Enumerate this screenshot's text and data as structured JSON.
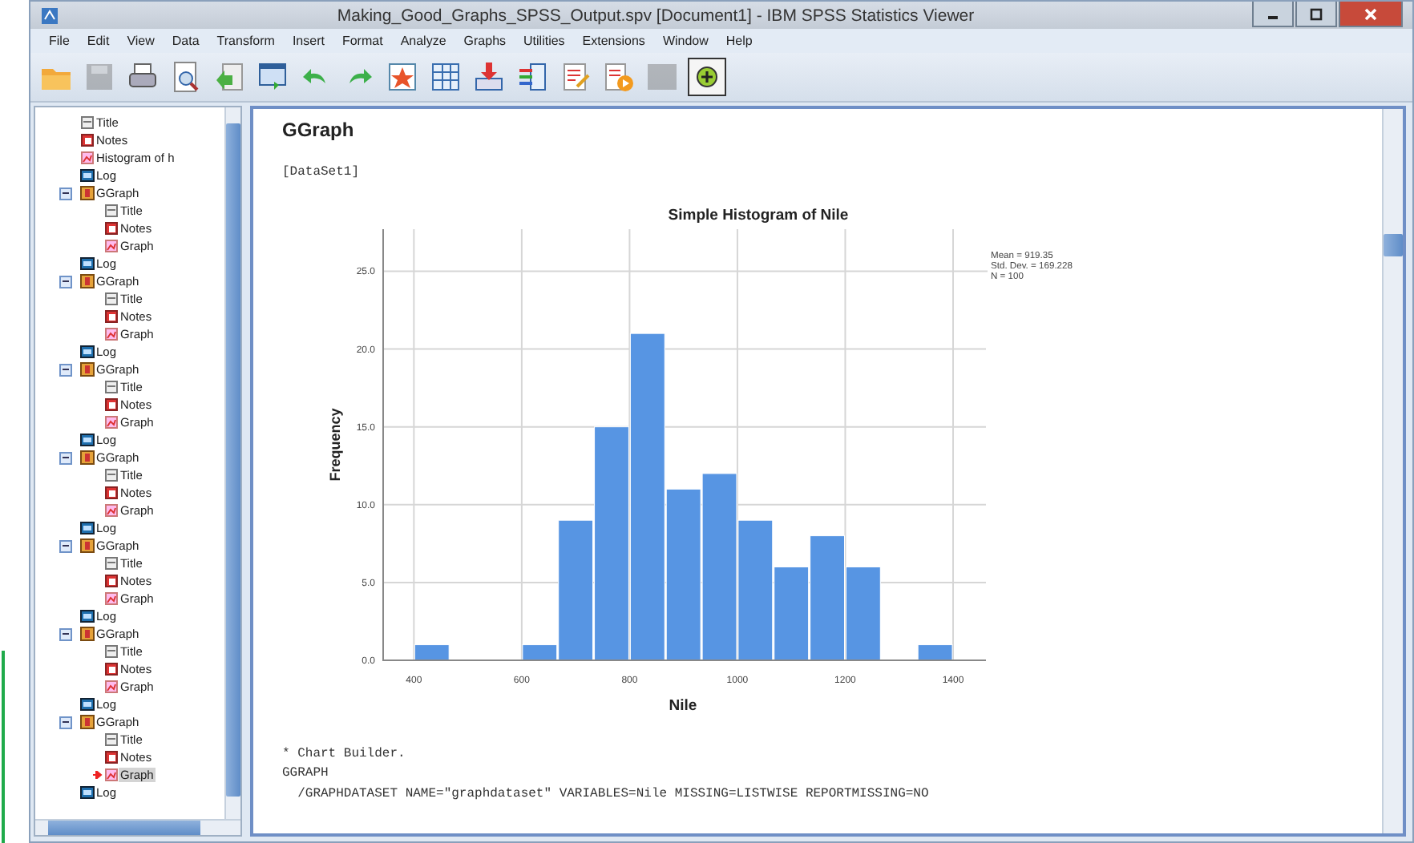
{
  "window": {
    "title": "Making_Good_Graphs_SPSS_Output.spv [Document1] - IBM SPSS Statistics Viewer"
  },
  "menu": [
    "File",
    "Edit",
    "View",
    "Data",
    "Transform",
    "Insert",
    "Format",
    "Analyze",
    "Graphs",
    "Utilities",
    "Extensions",
    "Window",
    "Help"
  ],
  "toolbar": [
    {
      "kind": "open",
      "disabled": false
    },
    {
      "kind": "save",
      "disabled": true
    },
    {
      "kind": "print",
      "disabled": false
    },
    {
      "kind": "preview",
      "disabled": false
    },
    {
      "kind": "export",
      "disabled": false
    },
    {
      "kind": "recall",
      "disabled": false
    },
    {
      "kind": "undo",
      "disabled": false
    },
    {
      "kind": "redo",
      "disabled": false
    },
    {
      "kind": "star",
      "disabled": false
    },
    {
      "kind": "grid",
      "disabled": false
    },
    {
      "kind": "download",
      "disabled": false
    },
    {
      "kind": "columns",
      "disabled": false
    },
    {
      "kind": "docpen",
      "disabled": false
    },
    {
      "kind": "docplay",
      "disabled": false
    },
    {
      "kind": "blank",
      "disabled": true
    },
    {
      "kind": "plus",
      "disabled": false
    }
  ],
  "outline": {
    "items": [
      {
        "kind": "group",
        "children": [
          {
            "kind": "title",
            "label": "Title",
            "selected": false
          },
          {
            "kind": "notes",
            "label": "Notes",
            "selected": false
          },
          {
            "kind": "graph",
            "label": "Histogram of h",
            "selected": false
          }
        ]
      },
      {
        "kind": "log",
        "label": "Log",
        "selected": false
      },
      {
        "kind": "ggraph",
        "label": "GGraph",
        "expanded": true,
        "selected": false,
        "children": [
          {
            "kind": "title",
            "label": "Title",
            "selected": false
          },
          {
            "kind": "notes",
            "label": "Notes",
            "selected": false
          },
          {
            "kind": "graph",
            "label": "Graph",
            "selected": false
          }
        ]
      },
      {
        "kind": "log",
        "label": "Log",
        "selected": false
      },
      {
        "kind": "ggraph",
        "label": "GGraph",
        "expanded": true,
        "selected": false,
        "children": [
          {
            "kind": "title",
            "label": "Title",
            "selected": false
          },
          {
            "kind": "notes",
            "label": "Notes",
            "selected": false
          },
          {
            "kind": "graph",
            "label": "Graph",
            "selected": false
          }
        ]
      },
      {
        "kind": "log",
        "label": "Log",
        "selected": false
      },
      {
        "kind": "ggraph",
        "label": "GGraph",
        "expanded": true,
        "selected": false,
        "children": [
          {
            "kind": "title",
            "label": "Title",
            "selected": false
          },
          {
            "kind": "notes",
            "label": "Notes",
            "selected": false
          },
          {
            "kind": "graph",
            "label": "Graph",
            "selected": false
          }
        ]
      },
      {
        "kind": "log",
        "label": "Log",
        "selected": false
      },
      {
        "kind": "ggraph",
        "label": "GGraph",
        "expanded": true,
        "selected": false,
        "children": [
          {
            "kind": "title",
            "label": "Title",
            "selected": false
          },
          {
            "kind": "notes",
            "label": "Notes",
            "selected": false
          },
          {
            "kind": "graph",
            "label": "Graph",
            "selected": false
          }
        ]
      },
      {
        "kind": "log",
        "label": "Log",
        "selected": false
      },
      {
        "kind": "ggraph",
        "label": "GGraph",
        "expanded": true,
        "selected": false,
        "children": [
          {
            "kind": "title",
            "label": "Title",
            "selected": false
          },
          {
            "kind": "notes",
            "label": "Notes",
            "selected": false
          },
          {
            "kind": "graph",
            "label": "Graph",
            "selected": false
          }
        ]
      },
      {
        "kind": "log",
        "label": "Log",
        "selected": false
      },
      {
        "kind": "ggraph",
        "label": "GGraph",
        "expanded": true,
        "selected": false,
        "children": [
          {
            "kind": "title",
            "label": "Title",
            "selected": false
          },
          {
            "kind": "notes",
            "label": "Notes",
            "selected": false
          },
          {
            "kind": "graph",
            "label": "Graph",
            "selected": false
          }
        ]
      },
      {
        "kind": "log",
        "label": "Log",
        "selected": false
      },
      {
        "kind": "ggraph",
        "label": "GGraph",
        "expanded": true,
        "selected": false,
        "children": [
          {
            "kind": "title",
            "label": "Title",
            "selected": false
          },
          {
            "kind": "notes",
            "label": "Notes",
            "selected": false
          },
          {
            "kind": "graph",
            "label": "Graph",
            "selected": true
          }
        ]
      },
      {
        "kind": "log",
        "label": "Log",
        "selected": false
      }
    ]
  },
  "output": {
    "heading": "GGraph",
    "dataset": "[DataSet1]",
    "chart": {
      "chart_data": {
        "type": "bar",
        "title": "Simple Histogram of Nile",
        "xlabel": "Nile",
        "ylabel": "Frequency",
        "x": [
          433.3,
          500,
          566.7,
          633.3,
          700,
          766.7,
          833.3,
          900,
          966.7,
          1033.3,
          1100,
          1166.7,
          1233.3,
          1300,
          1366.7
        ],
        "values": [
          1,
          0,
          0,
          1,
          9,
          15,
          21,
          11,
          12,
          9,
          6,
          8,
          6,
          0,
          1
        ],
        "xlim": [
          343,
          1455
        ],
        "ylim": [
          0,
          27.7
        ],
        "xticks": [
          400,
          600,
          800,
          1000,
          1200,
          1400
        ],
        "yticks": [
          {
            "value": 0,
            "label": "0.0"
          },
          {
            "value": 5,
            "label": "5.0"
          },
          {
            "value": 10,
            "label": "10.0"
          },
          {
            "value": 15,
            "label": "15.0"
          },
          {
            "value": 20,
            "label": "20.0"
          },
          {
            "value": 25,
            "label": "25.0"
          }
        ],
        "annotations": [
          "Mean = 919.35",
          "Std. Dev. = 169.228",
          "N = 100"
        ],
        "grid": true
      }
    },
    "syntax": [
      "* Chart Builder.",
      "GGRAPH",
      "  /GRAPHDATASET NAME=\"graphdataset\" VARIABLES=Nile MISSING=LISTWISE REPORTMISSING=NO"
    ]
  }
}
